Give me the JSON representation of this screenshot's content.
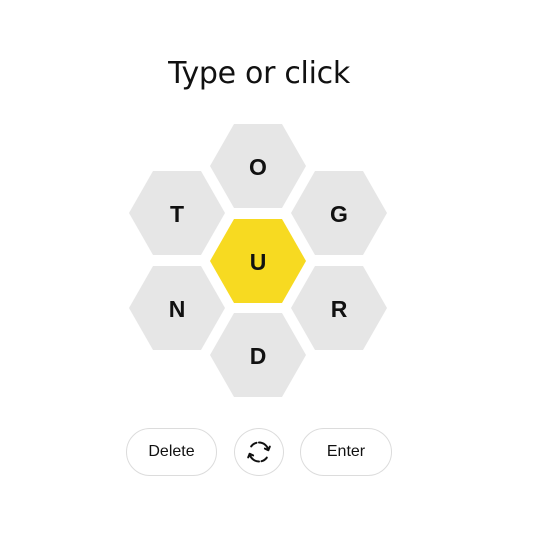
{
  "prompt": "Type or click",
  "hive": {
    "center": {
      "letter": "U",
      "color": "#f7da21"
    },
    "outer_color": "#e6e6e6",
    "outer": [
      {
        "position": "top",
        "letter": "O"
      },
      {
        "position": "upper-left",
        "letter": "T"
      },
      {
        "position": "upper-right",
        "letter": "G"
      },
      {
        "position": "lower-left",
        "letter": "N"
      },
      {
        "position": "lower-right",
        "letter": "R"
      },
      {
        "position": "bottom",
        "letter": "D"
      }
    ]
  },
  "controls": {
    "delete_label": "Delete",
    "shuffle_icon": "shuffle-icon",
    "enter_label": "Enter"
  }
}
